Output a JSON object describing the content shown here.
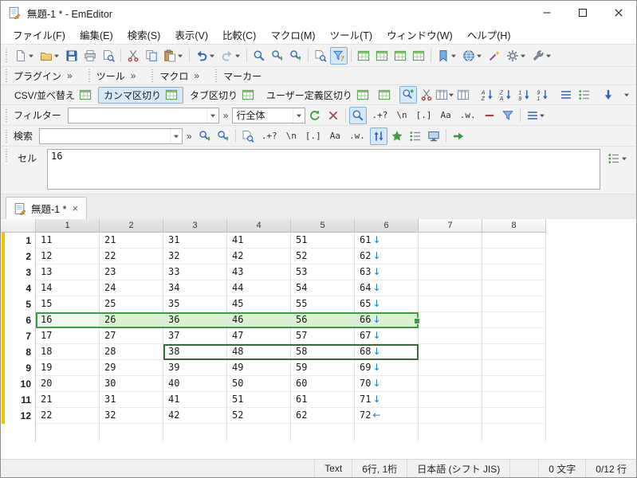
{
  "window": {
    "title": "無題-1 * - EmEditor"
  },
  "glyphs": {
    "chevron": "»",
    "close": "×"
  },
  "menu": {
    "items": [
      "ファイル(F)",
      "編集(E)",
      "検索(S)",
      "表示(V)",
      "比較(C)",
      "マクロ(M)",
      "ツール(T)",
      "ウィンドウ(W)",
      "ヘルプ(H)"
    ]
  },
  "toolbars": {
    "plugins": {
      "items": [
        "プラグイン",
        "ツール",
        "マクロ",
        "マーカー"
      ]
    },
    "csv": {
      "sort_label": "CSV/並べ替え",
      "comma_label": "カンマ区切り",
      "tab_label": "タブ区切り",
      "user_label": "ユーザー定義区切り"
    },
    "filter": {
      "label": "フィルター",
      "value": "",
      "scope_value": "行全体",
      "regex": ".+?",
      "newline": "\\n",
      "charclass": "[.]",
      "match_case": "Aa",
      "whole_word": ".w."
    },
    "search": {
      "label": "検索",
      "value": "",
      "regex": ".+?",
      "newline": "\\n",
      "charclass": "[.]",
      "match_case": "Aa",
      "whole_word": ".w."
    }
  },
  "cell_panel": {
    "label": "セル",
    "value": "16"
  },
  "tab": {
    "label": "無題-1 *"
  },
  "grid": {
    "columns": [
      "1",
      "2",
      "3",
      "4",
      "5",
      "6",
      "7",
      "8"
    ],
    "rows": [
      {
        "n": "1",
        "cells": [
          "11",
          "21",
          "31",
          "41",
          "51",
          "61"
        ],
        "eol": "↓"
      },
      {
        "n": "2",
        "cells": [
          "12",
          "22",
          "32",
          "42",
          "52",
          "62"
        ],
        "eol": "↓"
      },
      {
        "n": "3",
        "cells": [
          "13",
          "23",
          "33",
          "43",
          "53",
          "63"
        ],
        "eol": "↓"
      },
      {
        "n": "4",
        "cells": [
          "14",
          "24",
          "34",
          "44",
          "54",
          "64"
        ],
        "eol": "↓"
      },
      {
        "n": "5",
        "cells": [
          "15",
          "25",
          "35",
          "45",
          "55",
          "65"
        ],
        "eol": "↓"
      },
      {
        "n": "6",
        "cells": [
          "16",
          "26",
          "36",
          "46",
          "56",
          "66"
        ],
        "eol": "↓"
      },
      {
        "n": "7",
        "cells": [
          "17",
          "27",
          "37",
          "47",
          "57",
          "67"
        ],
        "eol": "↓"
      },
      {
        "n": "8",
        "cells": [
          "18",
          "28",
          "38",
          "48",
          "58",
          "68"
        ],
        "eol": "↓"
      },
      {
        "n": "9",
        "cells": [
          "19",
          "29",
          "39",
          "49",
          "59",
          "69"
        ],
        "eol": "↓"
      },
      {
        "n": "10",
        "cells": [
          "20",
          "30",
          "40",
          "50",
          "60",
          "70"
        ],
        "eol": "↓"
      },
      {
        "n": "11",
        "cells": [
          "21",
          "31",
          "41",
          "51",
          "61",
          "71"
        ],
        "eol": "↓"
      },
      {
        "n": "12",
        "cells": [
          "22",
          "32",
          "42",
          "52",
          "62",
          "72"
        ],
        "eol": "←"
      }
    ],
    "selection": {
      "primary_row": 6,
      "primary_col_start": 1,
      "primary_col_end": 6,
      "active_cell_value": "16",
      "secondary_row": 8,
      "secondary_col_start": 3,
      "secondary_col_end": 6
    }
  },
  "statusbar": {
    "doc_type": "Text",
    "caret_pos": "6行, 1桁",
    "encoding": "日本語 (シフト JIS)",
    "selection_chars": "0 文字",
    "selection_lines": "0/12 行"
  },
  "colors": {
    "accent_blue": "#2f66c4",
    "active_toolbar_bg": "#d6e9f8",
    "active_toolbar_border": "#7fb0dc",
    "selection_green_fill": "#dbf2d0",
    "selection_green_border": "#3aa047",
    "secondary_selection_border": "#356b3c",
    "eol_marker_blue": "#1b7fc4",
    "modified_line_yellow": "#f4c400"
  }
}
